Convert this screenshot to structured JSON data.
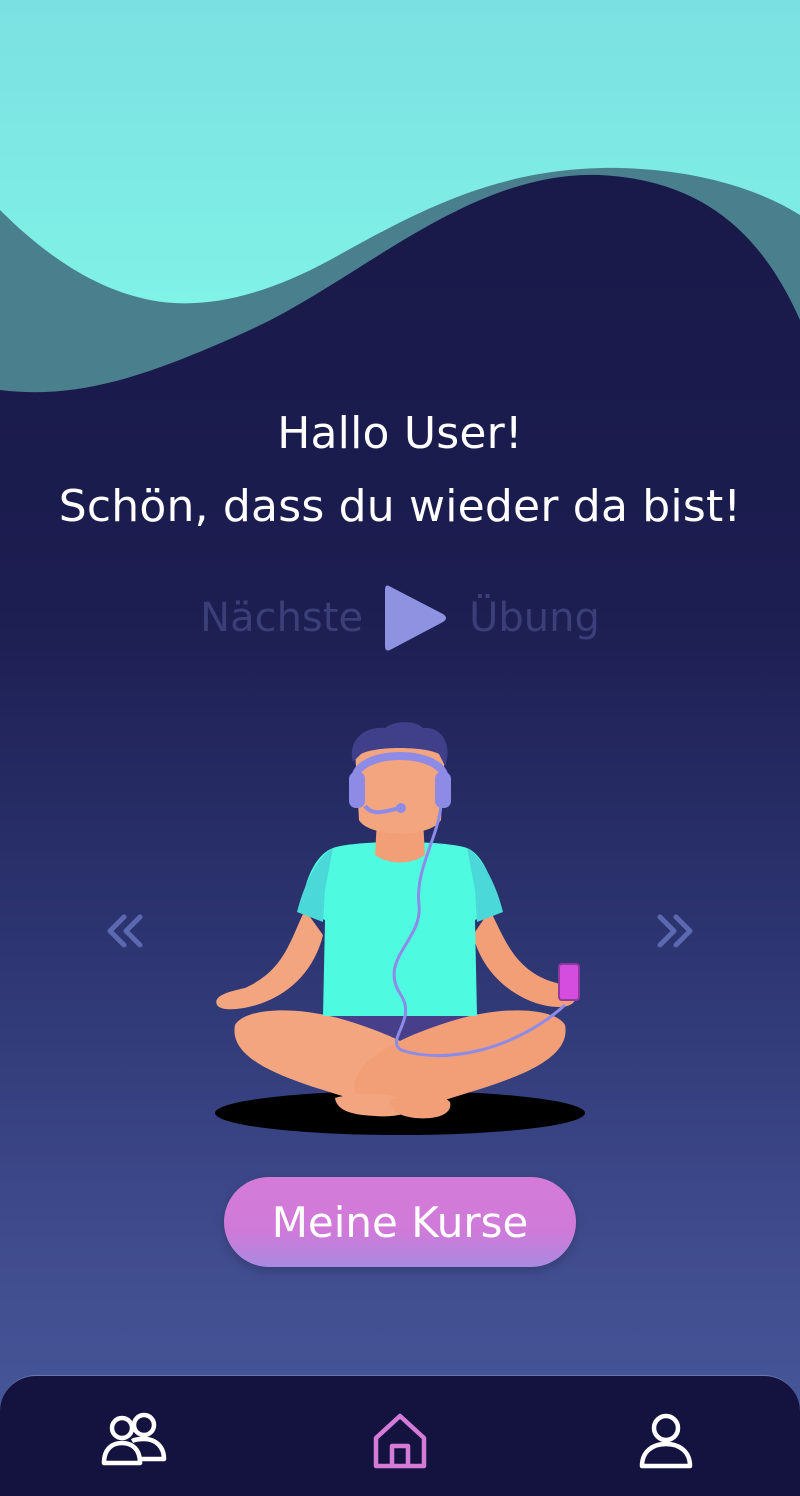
{
  "greeting": {
    "line1": "Hallo User!",
    "line2": "Schön, dass du wieder da bist!"
  },
  "next_exercise": {
    "label_left": "Nächste",
    "label_right": "Übung",
    "play_icon": "play-icon"
  },
  "carousel": {
    "prev_icon": "double-chevron-left-icon",
    "next_icon": "double-chevron-right-icon"
  },
  "courses_button": {
    "label": "Meine Kurse"
  },
  "bottom_nav": {
    "items": [
      {
        "id": "community",
        "icon": "users-icon",
        "active": false
      },
      {
        "id": "home",
        "icon": "home-icon",
        "active": true
      },
      {
        "id": "profile",
        "icon": "user-icon",
        "active": false
      }
    ]
  },
  "colors": {
    "background_top": "#171846",
    "background_bottom": "#4a5b9e",
    "wave_light": "#80eae4",
    "wave_dark": "#4a7f8e",
    "accent_pink": "#d47bd8",
    "play_blue": "#8e92e0",
    "nav_background": "#14133f",
    "nav_active": "#d47bd8",
    "nav_inactive": "#ffffff"
  }
}
